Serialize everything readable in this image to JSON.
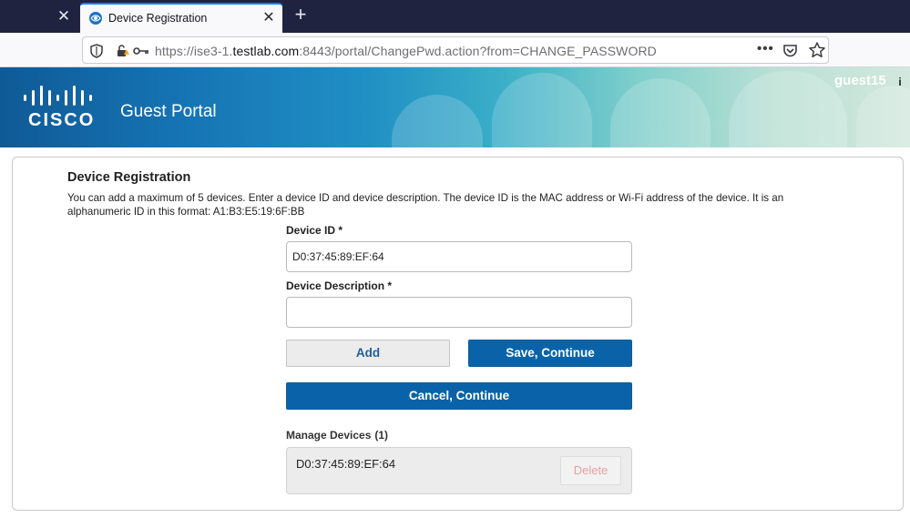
{
  "browser": {
    "active_tab_title": "Device Registration",
    "url": {
      "prefix": "https://ise3-1.",
      "host": "testlab.com",
      "suffix": ":8443/portal/ChangePwd.action?from=CHANGE_PASSWORD"
    },
    "accent_color": "#0a84ff"
  },
  "header": {
    "logo_text": "CISCO",
    "portal_title": "Guest Portal",
    "username": "guest15",
    "info_glyph": "i"
  },
  "registration": {
    "title": "Device Registration",
    "description": "You can add a maximum of 5 devices. Enter a device ID and device description. The device ID is the MAC address or Wi-Fi address of the device. It is an alphanumeric ID in this format: A1:B3:E5:19:6F:BB",
    "device_id_label": "Device ID *",
    "device_id_value": "D0:37:45:89:EF:64",
    "device_desc_label": "Device Description *",
    "device_desc_value": "",
    "add_label": "Add",
    "save_label": "Save, Continue",
    "cancel_label": "Cancel, Continue",
    "manage_label": "Manage Devices",
    "manage_count": "(1)",
    "devices": [
      {
        "id": "D0:37:45:89:EF:64",
        "delete_label": "Delete"
      }
    ],
    "primary_color": "#0a63a8"
  }
}
